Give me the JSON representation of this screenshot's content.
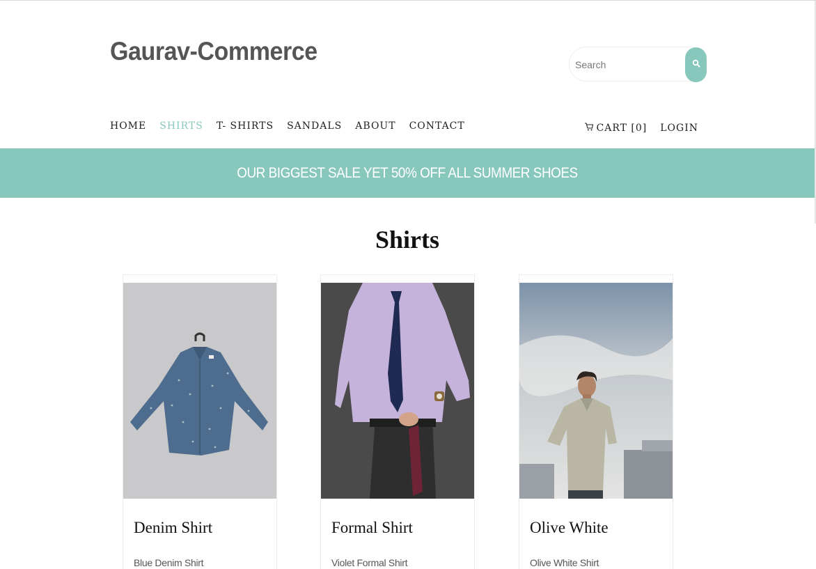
{
  "header": {
    "brand": "Gaurav-Commerce",
    "search": {
      "placeholder": "Search",
      "value": ""
    }
  },
  "nav": {
    "items": [
      {
        "label": "HOME",
        "active": false
      },
      {
        "label": "SHIRTS",
        "active": true
      },
      {
        "label": "T- SHIRTS",
        "active": false
      },
      {
        "label": "SANDALS",
        "active": false
      },
      {
        "label": "ABOUT",
        "active": false
      },
      {
        "label": "CONTACT",
        "active": false
      }
    ],
    "cart_label": "CART [0]",
    "login_label": "LOGIN"
  },
  "banner": {
    "text": "OUR BIGGEST SALE YET 50% OFF ALL SUMMER SHOES"
  },
  "section": {
    "title": "Shirts"
  },
  "products": [
    {
      "name": "Denim Shirt",
      "desc": "Blue Denim Shirt"
    },
    {
      "name": "Formal Shirt",
      "desc": "Violet Formal Shirt"
    },
    {
      "name": "Olive White",
      "desc": "Olive White Shirt"
    }
  ],
  "colors": {
    "accent": "#88c8bc",
    "brand_text": "#555555"
  }
}
